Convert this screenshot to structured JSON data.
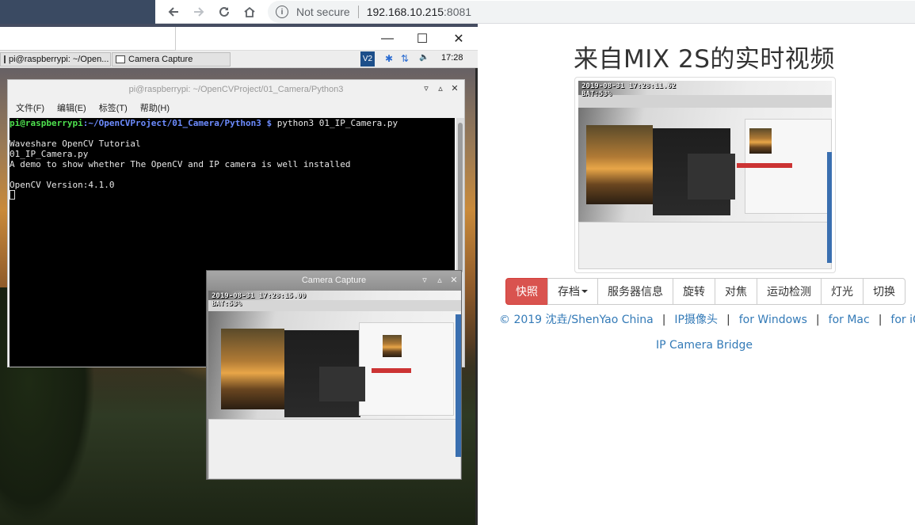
{
  "browser": {
    "security_label": "Not secure",
    "url_host": "192.168.10.215",
    "url_port": ":8081"
  },
  "taskbar": {
    "items": [
      "pi@raspberrypi: ~/Open...",
      "Camera Capture"
    ],
    "clock": "17:28",
    "tray_vnc": "V2"
  },
  "terminal": {
    "title": "pi@raspberrypi: ~/OpenCVProject/01_Camera/Python3",
    "menus": [
      "文件(F)",
      "编辑(E)",
      "标签(T)",
      "帮助(H)"
    ],
    "prompt_user": "pi@raspberrypi",
    "prompt_path": ":~/OpenCVProject/01_Camera/Python3 $",
    "command": " python3 01_IP_Camera.py",
    "output": [
      "Waveshare OpenCV Tutorial",
      "01_IP_Camera.py",
      "A demo to show whether The OpenCV and IP camera is well installed",
      "",
      "OpenCV Version:4.1.0"
    ]
  },
  "capture_window": {
    "title": "Camera Capture",
    "timestamp": "2019-08-31  17:28:15.00",
    "battery": "BAT:53%"
  },
  "webpage": {
    "title": "来自MIX 2S的实时视频",
    "stream_timestamp": "2019-08-31  17:28:11.62",
    "stream_battery": "BAT:53%",
    "buttons": [
      "快照",
      "存档",
      "服务器信息",
      "旋转",
      "对焦",
      "运动检测",
      "灯光",
      "切换"
    ],
    "links": [
      "© 2019 沈垚/ShenYao China",
      "IP摄像头",
      "for Windows",
      "for Mac",
      "for iOS"
    ],
    "bridge_link": "IP Camera Bridge"
  },
  "colors": {
    "danger": "#d9534f",
    "link": "#337ab7",
    "prompt_green": "#4ee04e",
    "prompt_blue": "#6d8cff"
  }
}
